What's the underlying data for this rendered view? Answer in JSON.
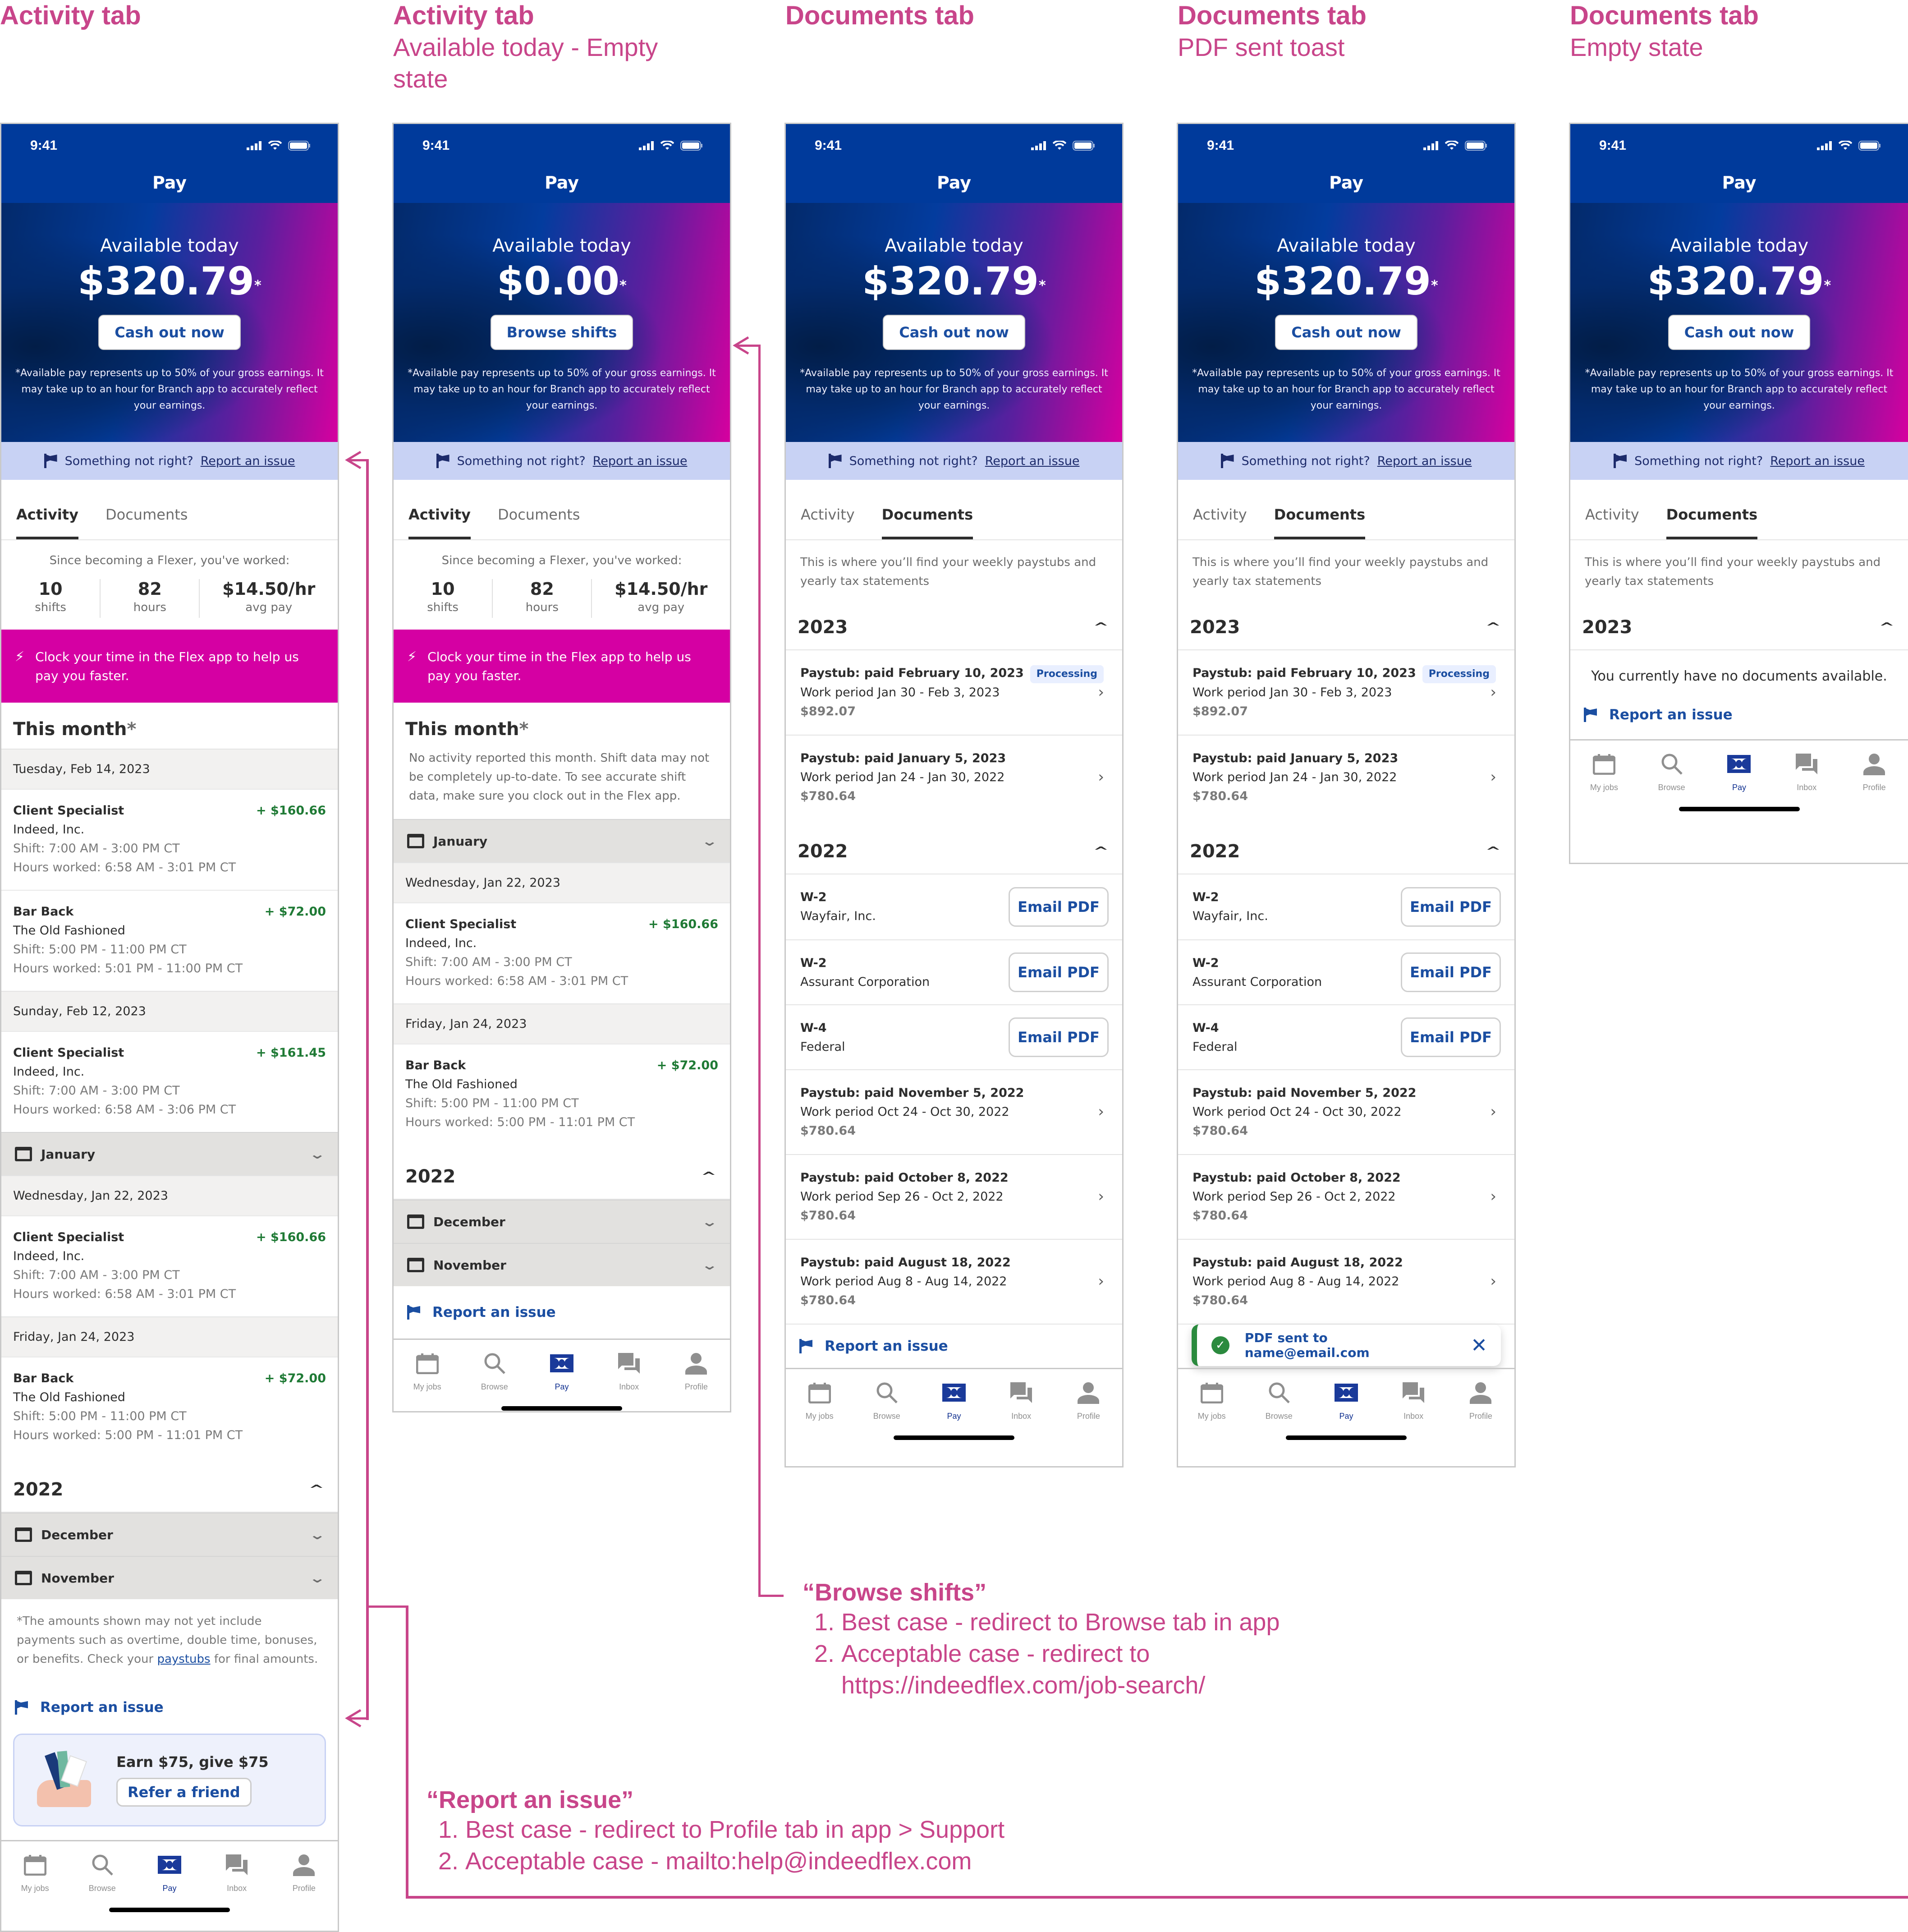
{
  "annotations": {
    "screens": [
      {
        "title": "Activity tab",
        "subtitle": ""
      },
      {
        "title": "Activity tab",
        "subtitle": "Available today - Empty state"
      },
      {
        "title": "Documents tab",
        "subtitle": ""
      },
      {
        "title": "Documents tab",
        "subtitle": "PDF sent toast"
      },
      {
        "title": "Documents tab",
        "subtitle": "Empty state"
      }
    ],
    "browse_note": {
      "heading": "“Browse shifts”",
      "items": [
        "Best case - redirect to Browse tab in app",
        "Acceptable case - redirect to https://indeedflex.com/job-search/"
      ]
    },
    "report_note": {
      "heading": "“Report an issue”",
      "items": [
        "Best case - redirect to Profile tab in app > Support",
        "Acceptable case - mailto:help@indeedflex.com"
      ]
    }
  },
  "common": {
    "time": "9:41",
    "app_title": "Pay",
    "available_label": "Available today",
    "asterisk": "*",
    "disclaimer": "*Available pay represents up to 50% of your gross earnings. It may take up to an hour for Branch app to accurately reflect your earnings.",
    "report_prompt": "Something not right?",
    "report_link": "Report an issue",
    "tabs": [
      "Activity",
      "Documents"
    ],
    "nav": [
      {
        "label": "My jobs",
        "icon": "calendar-icon"
      },
      {
        "label": "Browse",
        "icon": "search-icon"
      },
      {
        "label": "Pay",
        "icon": "money-icon"
      },
      {
        "label": "Inbox",
        "icon": "chat-icon"
      },
      {
        "label": "Profile",
        "icon": "person-icon"
      }
    ],
    "colors": {
      "brand_blue": "#003a9b",
      "accent_magenta": "#d500a3",
      "link_blue": "#1b4ea1",
      "positive_green": "#1f7a35",
      "annotation_pink": "#c8458a"
    }
  },
  "activity": {
    "amount": "$320.79",
    "cta": "Cash out now",
    "since_label": "Since becoming a Flexer, you've worked:",
    "stats": [
      {
        "value": "10",
        "label": "shifts"
      },
      {
        "value": "82",
        "label": "hours"
      },
      {
        "value": "$14.50/hr",
        "label": "avg pay"
      }
    ],
    "clock_banner": "Clock your time in the Flex app to help us pay you faster.",
    "this_month": "This month",
    "this_month_star": "*",
    "days": [
      {
        "date": "Tuesday, Feb 14, 2023",
        "shifts": [
          {
            "role": "Client Specialist",
            "company": "Indeed, Inc.",
            "shift": "Shift: 7:00 AM - 3:00 PM CT",
            "worked": "Hours worked: 6:58 AM - 3:01 PM CT",
            "amount": "+ $160.66"
          },
          {
            "role": "Bar Back",
            "company": "The Old Fashioned",
            "shift": "Shift: 5:00 PM - 11:00 PM CT",
            "worked": "Hours worked: 5:01 PM - 11:00 PM CT",
            "amount": "+ $72.00"
          }
        ]
      },
      {
        "date": "Sunday, Feb 12, 2023",
        "shifts": [
          {
            "role": "Client Specialist",
            "company": "Indeed, Inc.",
            "shift": "Shift: 7:00 AM - 3:00 PM CT",
            "worked": "Hours worked: 6:58 AM - 3:06 PM CT",
            "amount": "+ $161.45"
          }
        ]
      }
    ],
    "january": {
      "label": "January",
      "days": [
        {
          "date": "Wednesday, Jan 22, 2023",
          "role": "Client Specialist",
          "company": "Indeed, Inc.",
          "shift": "Shift: 7:00 AM - 3:00 PM CT",
          "worked": "Hours worked: 6:58 AM - 3:01 PM CT",
          "amount": "+ $160.66"
        },
        {
          "date": "Friday, Jan 24, 2023",
          "role": "Bar Back",
          "company": "The Old Fashioned",
          "shift": "Shift: 5:00 PM - 11:00 PM CT",
          "worked": "Hours worked: 5:00 PM - 11:01 PM CT",
          "amount": "+ $72.00"
        }
      ]
    },
    "year_2022": "2022",
    "months_2022": [
      "December",
      "November"
    ],
    "footnote_pre": "*The amounts shown may not yet include payments such as overtime, double time, bonuses, or benefits. Check your ",
    "footnote_link": "paystubs",
    "footnote_post": " for final amounts.",
    "referral": {
      "heading": "Earn $75, give $75",
      "button": "Refer a friend"
    }
  },
  "activity_empty": {
    "amount": "$0.00",
    "cta": "Browse shifts",
    "empty_message": "No activity reported this month. Shift data may not be completely up-to-date. To see accurate shift data, make sure you clock out in the Flex app."
  },
  "documents": {
    "intro": "This is where you’ll find your weekly paystubs and yearly tax statements",
    "years": [
      {
        "year": "2023",
        "rows": [
          {
            "title": "Paystub: paid February 10, 2023",
            "badge": "Processing",
            "period": "Work period Jan 30 - Feb 3, 2023",
            "amount": "$892.07"
          },
          {
            "title": "Paystub: paid January 5, 2023",
            "badge": "",
            "period": "Work period Jan 24 - Jan 30, 2022",
            "amount": "$780.64"
          }
        ]
      },
      {
        "year": "2022",
        "tax_forms": [
          {
            "form": "W-2",
            "issuer": "Wayfair, Inc.",
            "button": "Email PDF"
          },
          {
            "form": "W-2",
            "issuer": "Assurant Corporation",
            "button": "Email PDF"
          },
          {
            "form": "W-4",
            "issuer": "Federal",
            "button": "Email PDF"
          }
        ],
        "rows": [
          {
            "title": "Paystub: paid November 5, 2022",
            "period": "Work period Oct 24 - Oct 30, 2022",
            "amount": "$780.64"
          },
          {
            "title": "Paystub: paid October 8, 2022",
            "period": "Work period Sep 26 - Oct 2, 2022",
            "amount": "$780.64"
          },
          {
            "title": "Paystub: paid August 18, 2022",
            "period": "Work period Aug 8 - Aug 14, 2022",
            "amount": "$780.64"
          }
        ]
      }
    ],
    "toast": "PDF sent to name@email.com",
    "empty_message": "You currently have no documents available."
  }
}
